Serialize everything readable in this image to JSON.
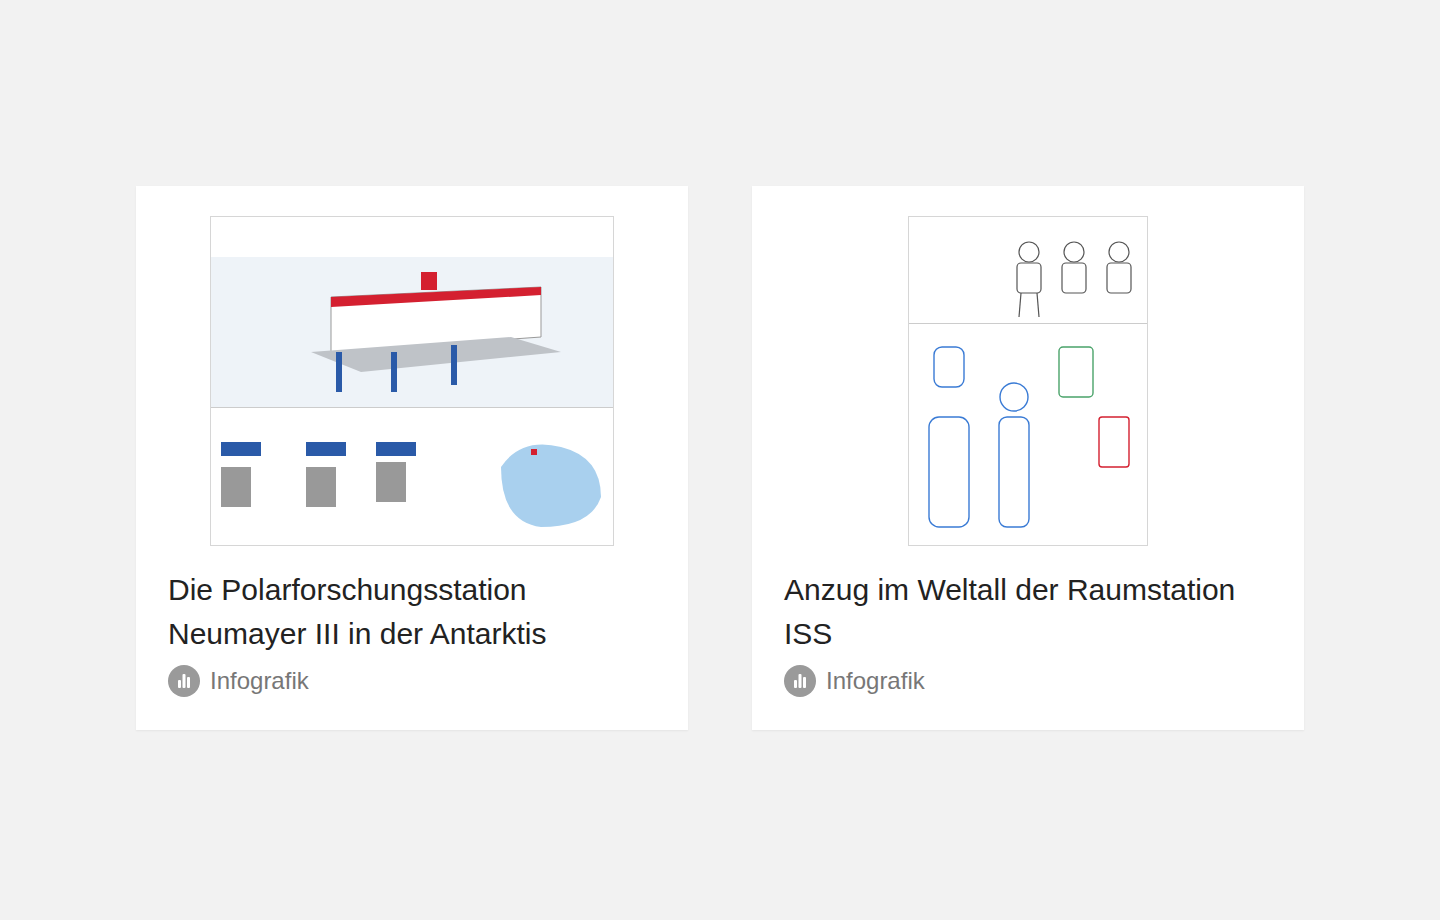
{
  "cards": [
    {
      "title": "Die Polarforschungsstation Neumayer III in der Antarktis",
      "category": "Infografik",
      "kind": "station"
    },
    {
      "title": "Anzug im Weltall der Raumstation ISS",
      "category": "Infografik",
      "kind": "suit"
    }
  ]
}
